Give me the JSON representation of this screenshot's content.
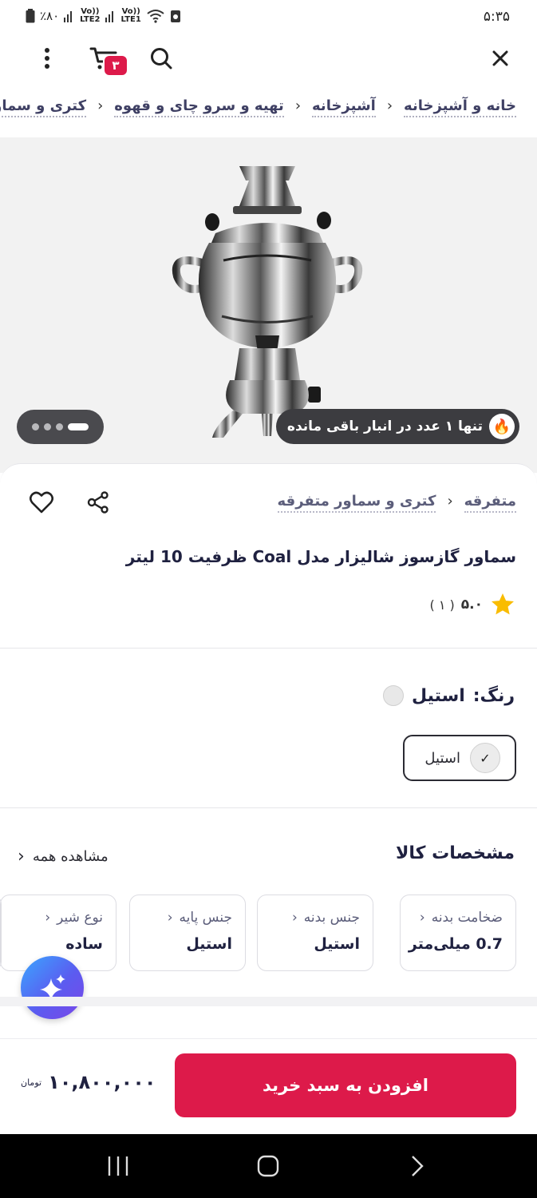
{
  "status_bar": {
    "time": "۵:۳۵",
    "battery": "٪۸۰",
    "sim1": "LTE2",
    "sim2": "LTE1",
    "volte": "Vo))"
  },
  "top_bar": {
    "cart_count": "۳",
    "icons": [
      "close-icon",
      "search-icon",
      "cart-icon",
      "more-vertical-icon"
    ]
  },
  "breadcrumb": [
    "خانه و آشپزخانه",
    "آشپزخانه",
    "تهیه و سرو چای و قهوه",
    "کتری و سماور"
  ],
  "gallery": {
    "stock_text": "تنها ۱ عدد در انبار باقی مانده",
    "stock_icon": "🔥"
  },
  "product": {
    "categories": [
      "متفرقه",
      "کتری و سماور متفرقه"
    ],
    "title": "سماور گازسوز شالیزار مدل Coal ظرفیت 10 لیتر",
    "rating": "۵.۰",
    "rating_count": "( ۱ )"
  },
  "color": {
    "heading": "رنگ:",
    "selected": "استیل",
    "option_label": "استیل"
  },
  "specs": {
    "heading": "مشخصات کالا",
    "see_all": "مشاهده همه",
    "items": [
      {
        "label": "ضخامت بدنه",
        "value": "0.7 میلی‌متر"
      },
      {
        "label": "جنس بدنه",
        "value": "استیل"
      },
      {
        "label": "جنس پایه",
        "value": "استیل"
      },
      {
        "label": "نوع شیر",
        "value": "ساده"
      }
    ]
  },
  "bottom": {
    "add_to_cart": "افزودن به سبد خرید",
    "price": "۱۰,۸۰۰,۰۰۰",
    "currency": "تومان"
  },
  "colors": {
    "primary": "#dd1a4a",
    "text": "#1f2140",
    "star": "#f9bc00"
  }
}
